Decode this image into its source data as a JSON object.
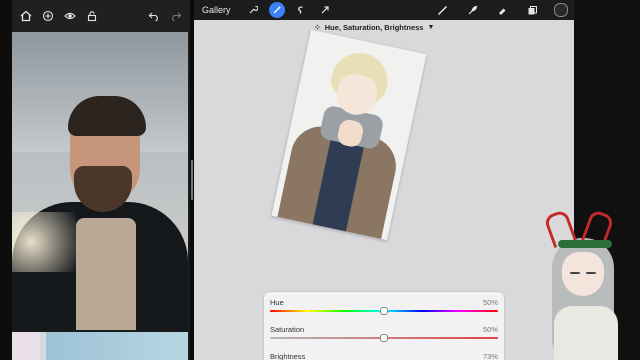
{
  "left_app": {
    "toolbar_icons": [
      "home-icon",
      "plus-circle-icon",
      "eye-icon",
      "lock-icon",
      "undo-icon",
      "redo-icon"
    ]
  },
  "procreate": {
    "gallery_label": "Gallery",
    "tools": [
      "wrench-icon",
      "magic-wand-icon",
      "selection-icon",
      "transform-arrow-icon"
    ],
    "right_tools": [
      "brush-icon",
      "smudge-icon",
      "eraser-icon",
      "layers-icon"
    ],
    "color": "#2a2a2a",
    "mode_label": "Hue, Saturation, Brightness",
    "mode_caret": "▼"
  },
  "adjustments": {
    "rows": [
      {
        "label": "Hue",
        "value": "50%",
        "level": 0.5
      },
      {
        "label": "Saturation",
        "value": "50%",
        "level": 0.5
      },
      {
        "label": "Brightness",
        "value": "73%",
        "level": 0.73
      }
    ]
  }
}
